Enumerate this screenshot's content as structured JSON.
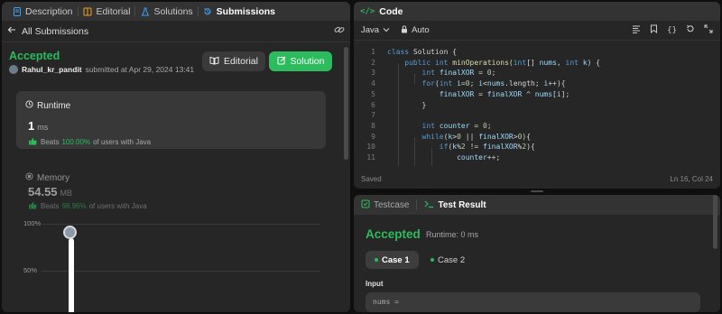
{
  "left_tabs": [
    {
      "label": "Description",
      "icon": "document-icon"
    },
    {
      "label": "Editorial",
      "icon": "book-icon"
    },
    {
      "label": "Solutions",
      "icon": "flask-icon"
    },
    {
      "label": "Submissions",
      "icon": "history-icon"
    }
  ],
  "submission": {
    "back_label": "All Submissions",
    "status": "Accepted",
    "username": "Rahul_kr_pandit",
    "submitted_text": "submitted at Apr 29, 2024 13:41",
    "editorial_button": "Editorial",
    "solution_button": "Solution"
  },
  "runtime": {
    "title": "Runtime",
    "value": "1",
    "unit": "ms",
    "beats_prefix": "Beats",
    "beats_pct": "100.00%",
    "beats_suffix": "of users with Java"
  },
  "memory": {
    "title": "Memory",
    "value": "54.55",
    "unit": "MB",
    "beats_prefix": "Beats",
    "beats_pct": "98.96%",
    "beats_suffix": "of users with Java"
  },
  "distribution": {
    "labels": [
      "100%",
      "50%"
    ],
    "bar_fraction": 0.98
  },
  "code": {
    "title": "Code",
    "language": "Java",
    "mode": "Auto",
    "saved": "Saved",
    "cursor": "Ln 16, Col 24",
    "line_numbers": [
      "1",
      "2",
      "3",
      "4",
      "5",
      "6",
      "7",
      "8",
      "9",
      "10",
      "11"
    ]
  },
  "test": {
    "tab_testcase": "Testcase",
    "tab_result": "Test Result",
    "status": "Accepted",
    "runtime": "Runtime: 0 ms",
    "cases": [
      "Case 1",
      "Case 2"
    ],
    "input_label": "Input",
    "input_value": "nums ="
  },
  "colors": {
    "accent_green": "#2cbb5d",
    "active_tab_blue": "#3c9ef5"
  }
}
